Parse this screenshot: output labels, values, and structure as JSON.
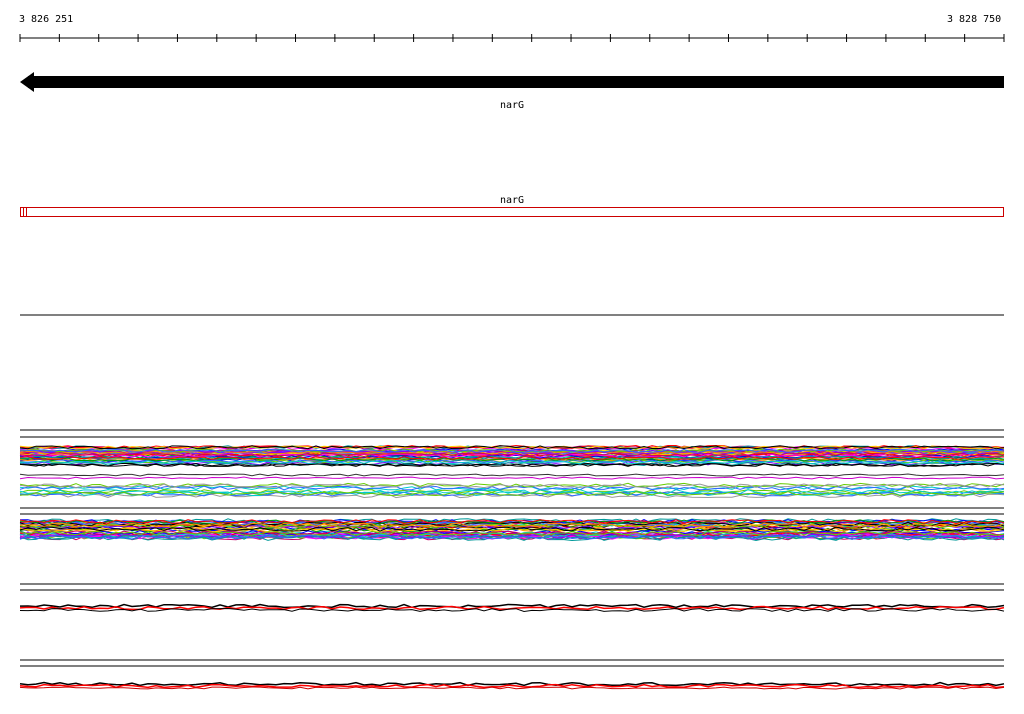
{
  "ruler": {
    "start_label": "3 826 251",
    "end_label": "3 828 750"
  },
  "gene_track": {
    "gene_name": "narG",
    "strand": "reverse",
    "color": "#000000"
  },
  "annotation_track": {
    "gene_name": "narG",
    "outline_color": "#cc0000"
  },
  "colors": {
    "background": "#ffffff",
    "axis": "#000000",
    "coverage_palette": [
      "#ff0000",
      "#00a000",
      "#0000ff",
      "#ff00ff",
      "#00cccc",
      "#ffcc00",
      "#8800ff",
      "#ff8800",
      "#009999",
      "#cc0066",
      "#66cc00",
      "#3366ff",
      "#000000"
    ]
  }
}
